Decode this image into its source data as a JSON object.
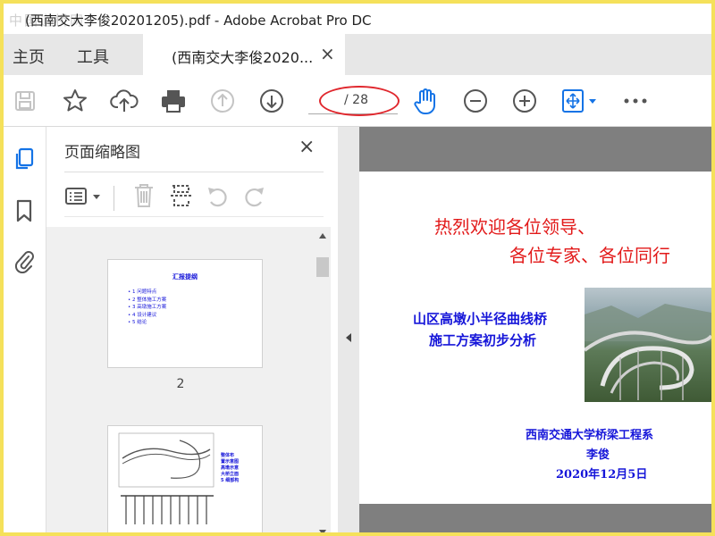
{
  "app": {
    "watermark": "中国道桥网",
    "window_title": "(西南交大李俊20201205).pdf - Adobe Acrobat Pro DC"
  },
  "nav": {
    "home": "主页",
    "tools": "工具",
    "doc_tab": "(西南交大李俊2020...",
    "close_glyph": "×"
  },
  "toolbar": {
    "page_total": "/ 28",
    "icons": [
      "save-icon",
      "star-icon",
      "cloud-upload-icon",
      "print-icon",
      "page-up-icon",
      "page-down-icon",
      "hand-icon",
      "zoom-out-icon",
      "zoom-in-icon",
      "fit-page-icon",
      "more-icon"
    ],
    "ring_color": "#e0282e"
  },
  "panel": {
    "title": "页面缩略图",
    "close_glyph": "×",
    "thumb_page_label": "2"
  },
  "thumbnail_page2": {
    "heading": "汇报提纲",
    "items": [
      "1 问题特点",
      "2 整体施工方案",
      "3 高墩施工方案",
      "4 设计建议",
      "5 结论"
    ]
  },
  "thumbnail_page3": {
    "items": [
      "整体布",
      "置示意图",
      "高墩示意",
      "大桥立面",
      "5 细部构"
    ]
  },
  "slide": {
    "welcome_line1": "热烈欢迎各位领导、",
    "welcome_line2": "各位专家、各位同行",
    "title_line1": "山区高墩小半径曲线桥",
    "title_line2": "施工方案初步分析",
    "org": "西南交通大学桥梁工程系",
    "author": "李俊",
    "date": "2020年12月5日"
  },
  "colors": {
    "accent": "#1473e6",
    "red_text": "#e21a1a",
    "blue_text": "#1515d9",
    "frame": "#f5e15a"
  }
}
